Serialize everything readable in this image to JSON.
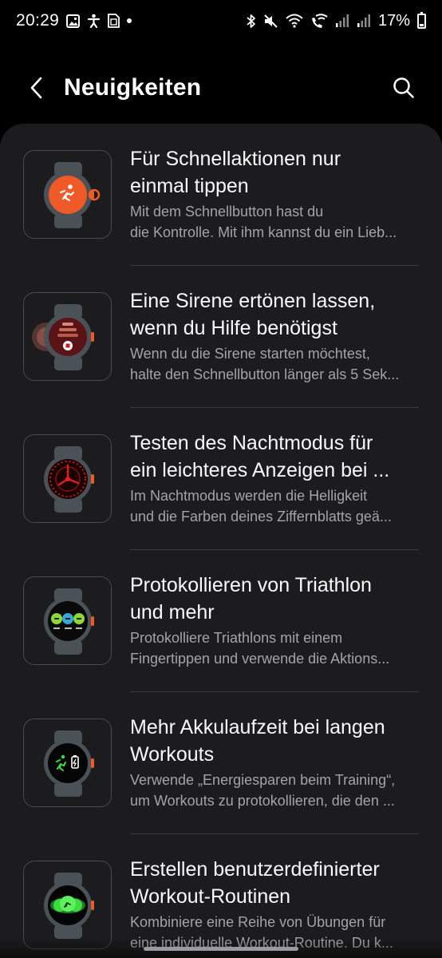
{
  "status_bar": {
    "time": "20:29",
    "battery": "17%",
    "left_icons": [
      "gallery-icon",
      "accessibility-icon",
      "sim-icon",
      "dot-icon"
    ],
    "right_icons": [
      "bluetooth-icon",
      "mute-icon",
      "wifi-icon",
      "wifi-calling-icon",
      "signal-icon",
      "signal-icon",
      "battery-icon"
    ]
  },
  "header": {
    "title": "Neuigkeiten",
    "back_icon": "chevron-left-icon",
    "search_icon": "search-icon"
  },
  "items": [
    {
      "title_line1": "Für Schnellaktionen nur",
      "title_line2": "einmal tippen",
      "desc_line1": "Mit dem Schnellbutton hast du",
      "desc_line2": "die Kontrolle. Mit ihm kannst du ein Lieb..."
    },
    {
      "title_line1": "Eine Sirene ertönen lassen,",
      "title_line2": "wenn du Hilfe benötigst",
      "desc_line1": "Wenn du die Sirene starten möchtest,",
      "desc_line2": "halte den Schnellbutton länger als 5 Sek..."
    },
    {
      "title_line1": "Testen des Nachtmodus für",
      "title_line2": "ein leichteres Anzeigen bei ...",
      "desc_line1": "Im Nachtmodus werden die Helligkeit",
      "desc_line2": "und die Farben deines Ziffernblatts geä..."
    },
    {
      "title_line1": "Protokollieren von Triathlon",
      "title_line2": "und mehr",
      "desc_line1": "Protokolliere Triathlons mit einem",
      "desc_line2": "Fingertippen und verwende die Aktions..."
    },
    {
      "title_line1": "Mehr Akkulaufzeit bei langen",
      "title_line2": "Workouts",
      "desc_line1": "Verwende „Energiesparen beim Training“,",
      "desc_line2": "um Workouts zu protokollieren, die den ..."
    },
    {
      "title_line1": "Erstellen benutzerdefinierter",
      "title_line2": "Workout-Routinen",
      "desc_line1": "Kombiniere eine Reihe von Übungen für",
      "desc_line2": "eine individuelle Workout-Routine. Du k..."
    }
  ],
  "colors": {
    "background": "#000000",
    "card": "#1c1c1e",
    "watch_body": "#4a5258",
    "accent_orange": "#f05a28",
    "accent_green": "#3ddc3d",
    "night_red": "#d01818"
  }
}
